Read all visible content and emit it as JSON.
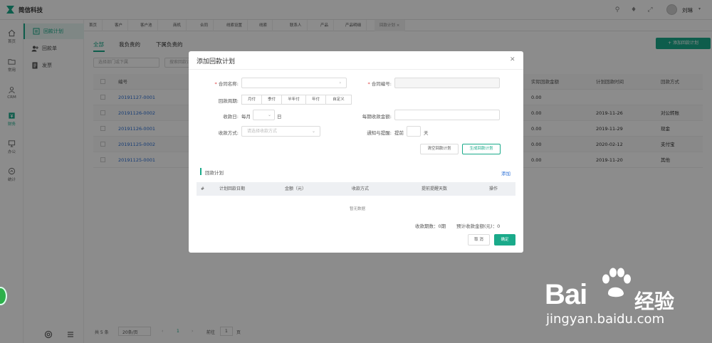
{
  "app": {
    "brand": "简信科技",
    "username": "刘琳"
  },
  "iconbar": [
    {
      "label": "首页",
      "icon": "home-icon"
    },
    {
      "label": "常用",
      "icon": "folder-icon"
    },
    {
      "label": "CRM",
      "icon": "users-icon"
    },
    {
      "label": "财务",
      "icon": "finance-icon"
    },
    {
      "label": "办公",
      "icon": "monitor-icon"
    },
    {
      "label": "统计",
      "icon": "stats-icon"
    }
  ],
  "sidenav": [
    {
      "label": "回款计划",
      "icon": "plan-icon"
    },
    {
      "label": "回款单",
      "icon": "receipt-icon"
    },
    {
      "label": "发票",
      "icon": "invoice-icon"
    }
  ],
  "tabs": [
    "首页",
    "客户",
    "客户池",
    "商机",
    "合同",
    "线索设置",
    "线索",
    "联系人",
    "产品",
    "产品明细",
    "回款计划 ×"
  ],
  "subtabs": [
    "全部",
    "我负责的",
    "下属负责的"
  ],
  "add_button": "+ 添加回款计划",
  "filters": {
    "dept": "选择部门或下属",
    "search": "搜索回款计划"
  },
  "table": {
    "headers": {
      "code": "编号",
      "actual": "实际回款金额",
      "plan_time": "计划回款时间",
      "method": "回款方式"
    },
    "rows": [
      {
        "code": "20191127-0001",
        "actual": "0.00",
        "plan_time": "",
        "method": ""
      },
      {
        "code": "20191126-0002",
        "actual": "0.00",
        "plan_time": "2019-11-26",
        "method": "对公转账"
      },
      {
        "code": "20191126-0001",
        "actual": "0.00",
        "plan_time": "2019-11-29",
        "method": "现金"
      },
      {
        "code": "20191125-0002",
        "actual": "0.00",
        "plan_time": "2020-02-12",
        "method": "支付宝"
      },
      {
        "code": "20191125-0001",
        "actual": "0.00",
        "plan_time": "2019-11-20",
        "method": "其他"
      }
    ]
  },
  "pager": {
    "total": "共 5 条",
    "size": "20条/页",
    "page": "1",
    "goto": "前往",
    "goto_page": "1",
    "goto_unit": "页"
  },
  "modal": {
    "title": "添加回款计划",
    "contract_name_label": "合同名称:",
    "contract_no_label": "合同编号:",
    "cycle_label": "回款周期:",
    "cycles": [
      "月付",
      "季付",
      "半年付",
      "年付",
      "自定义"
    ],
    "collect_day_label": "收款日:",
    "each_month": "每月",
    "day_unit": "日",
    "each_amount_label": "每期收款金额:",
    "method_label": "收款方式:",
    "method_placeholder": "请选择收款方式",
    "notify_label": "通知与提醒:",
    "notify_before": "提前",
    "notify_unit": "天",
    "clear_btn": "清空回款计划",
    "gen_btn": "生成回款计划",
    "section_title": "回款计划",
    "add_link": "添加",
    "plan_headers": [
      "#",
      "计划回款日期",
      "金额（元）",
      "收款方式",
      "提前提醒天数",
      "操作"
    ],
    "empty": "暂无数据",
    "count_summary": "收款期数：0期",
    "amount_summary": "预计收款金额(元)：0",
    "cancel": "取 消",
    "confirm": "确定"
  },
  "watermark": {
    "text": "Bai",
    "text2": "经验",
    "url": "jingyan.baidu.com"
  },
  "colors": {
    "accent": "#1aaa8a",
    "link": "#2a6fd6"
  }
}
